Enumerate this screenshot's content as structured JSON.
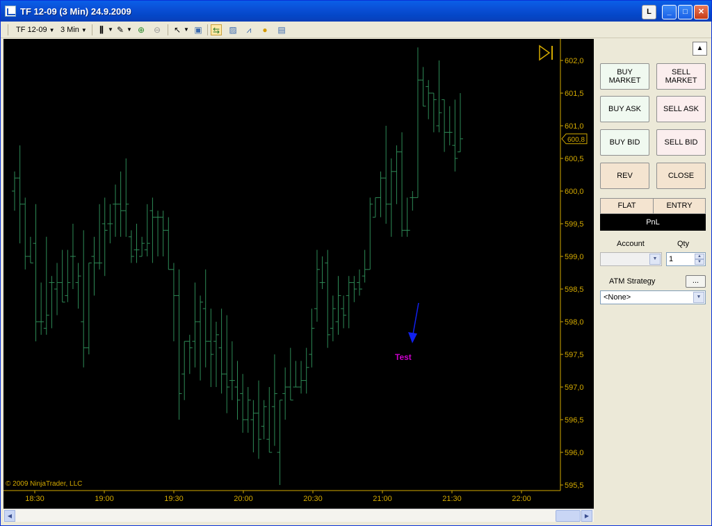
{
  "window": {
    "title": "TF 12-09 (3 Min)  24.9.2009",
    "btn_l": "L",
    "btn_min": "_",
    "btn_max": "□",
    "btn_close": "✕"
  },
  "toolbar": {
    "instrument": "TF 12-09",
    "interval": "3 Min"
  },
  "chart": {
    "copyright": "© 2009 NinjaTrader, LLC",
    "annotation_text": "Test",
    "last_price_label": "600,8",
    "colors": {
      "bar": "#2e8b57",
      "axis": "#d4aa00",
      "annotation": "#cc00cc",
      "arrow": "#1020ee"
    }
  },
  "chart_data": {
    "type": "ohlc",
    "y_axis_ticks": [
      "602,0",
      "601,5",
      "601,0",
      "600,5",
      "600,0",
      "599,5",
      "599,0",
      "598,5",
      "598,0",
      "597,5",
      "597,0",
      "596,5",
      "596,0",
      "595,5"
    ],
    "x_axis_ticks": [
      "18:30",
      "19:00",
      "19:30",
      "20:00",
      "20:30",
      "21:00",
      "21:30",
      "22:00"
    ],
    "ylim": [
      595.4,
      602.2
    ],
    "last_price": 600.8,
    "bars": [
      {
        "o": 600.0,
        "h": 600.3,
        "l": 599.7,
        "c": 600.2
      },
      {
        "o": 600.2,
        "h": 600.7,
        "l": 599.2,
        "c": 599.8
      },
      {
        "o": 599.8,
        "h": 599.9,
        "l": 598.8,
        "c": 599.0
      },
      {
        "o": 599.0,
        "h": 599.3,
        "l": 598.9,
        "c": 598.9
      },
      {
        "o": 599.2,
        "h": 599.8,
        "l": 597.7,
        "c": 598.0
      },
      {
        "o": 598.0,
        "h": 598.6,
        "l": 597.8,
        "c": 598.0
      },
      {
        "o": 597.9,
        "h": 599.3,
        "l": 597.8,
        "c": 598.1
      },
      {
        "o": 598.6,
        "h": 598.7,
        "l": 597.9,
        "c": 598.6
      },
      {
        "o": 598.5,
        "h": 598.9,
        "l": 598.1,
        "c": 598.6
      },
      {
        "o": 598.6,
        "h": 599.1,
        "l": 598.3,
        "c": 598.3
      },
      {
        "o": 598.4,
        "h": 599.1,
        "l": 598.3,
        "c": 598.6
      },
      {
        "o": 599.0,
        "h": 599.5,
        "l": 598.5,
        "c": 599.0
      },
      {
        "o": 598.6,
        "h": 598.9,
        "l": 598.2,
        "c": 598.7
      },
      {
        "o": 598.0,
        "h": 599.4,
        "l": 597.3,
        "c": 597.6
      },
      {
        "o": 597.6,
        "h": 598.9,
        "l": 597.5,
        "c": 598.9
      },
      {
        "o": 599.0,
        "h": 599.3,
        "l": 598.4,
        "c": 598.9
      },
      {
        "o": 598.9,
        "h": 599.8,
        "l": 598.8,
        "c": 598.9
      },
      {
        "o": 599.5,
        "h": 599.9,
        "l": 598.7,
        "c": 599.4
      },
      {
        "o": 599.5,
        "h": 599.8,
        "l": 599.2,
        "c": 599.5
      },
      {
        "o": 599.8,
        "h": 600.1,
        "l": 599.3,
        "c": 599.8
      },
      {
        "o": 599.8,
        "h": 600.3,
        "l": 599.3,
        "c": 599.7
      },
      {
        "o": 599.7,
        "h": 600.5,
        "l": 599.3,
        "c": 599.8
      },
      {
        "o": 599.3,
        "h": 599.4,
        "l": 598.9,
        "c": 599.0
      },
      {
        "o": 599.1,
        "h": 599.5,
        "l": 598.9,
        "c": 599.1
      },
      {
        "o": 599.0,
        "h": 599.3,
        "l": 599.0,
        "c": 599.2
      },
      {
        "o": 599.1,
        "h": 599.8,
        "l": 599.0,
        "c": 599.2
      },
      {
        "o": 599.7,
        "h": 599.9,
        "l": 598.9,
        "c": 599.6
      },
      {
        "o": 599.6,
        "h": 599.7,
        "l": 599.0,
        "c": 599.6
      },
      {
        "o": 599.6,
        "h": 599.7,
        "l": 599.0,
        "c": 599.4
      },
      {
        "o": 599.4,
        "h": 599.6,
        "l": 598.8,
        "c": 598.8
      },
      {
        "o": 598.8,
        "h": 598.9,
        "l": 597.7,
        "c": 598.4
      },
      {
        "o": 598.4,
        "h": 598.8,
        "l": 596.5,
        "c": 596.9
      },
      {
        "o": 597.2,
        "h": 597.7,
        "l": 596.8,
        "c": 597.7
      },
      {
        "o": 597.7,
        "h": 597.8,
        "l": 597.2,
        "c": 597.6
      },
      {
        "o": 597.7,
        "h": 598.6,
        "l": 597.3,
        "c": 598.0
      },
      {
        "o": 598.0,
        "h": 598.4,
        "l": 597.1,
        "c": 598.3
      },
      {
        "o": 598.2,
        "h": 598.8,
        "l": 597.3,
        "c": 597.7
      },
      {
        "o": 597.7,
        "h": 598.2,
        "l": 597.0,
        "c": 597.5
      },
      {
        "o": 597.7,
        "h": 598.0,
        "l": 597.0,
        "c": 597.8
      },
      {
        "o": 597.6,
        "h": 598.2,
        "l": 596.9,
        "c": 597.2
      },
      {
        "o": 597.2,
        "h": 598.1,
        "l": 596.6,
        "c": 597.0
      },
      {
        "o": 597.1,
        "h": 597.7,
        "l": 596.8,
        "c": 597.1
      },
      {
        "o": 597.0,
        "h": 597.4,
        "l": 596.5,
        "c": 596.8
      },
      {
        "o": 596.9,
        "h": 597.2,
        "l": 596.3,
        "c": 596.5
      },
      {
        "o": 596.5,
        "h": 597.0,
        "l": 596.3,
        "c": 596.8
      },
      {
        "o": 596.5,
        "h": 596.8,
        "l": 596.0,
        "c": 596.6
      },
      {
        "o": 596.6,
        "h": 597.1,
        "l": 595.9,
        "c": 596.2
      },
      {
        "o": 596.4,
        "h": 596.8,
        "l": 596.2,
        "c": 596.7
      },
      {
        "o": 596.2,
        "h": 597.0,
        "l": 596.0,
        "c": 596.0
      },
      {
        "o": 596.7,
        "h": 597.5,
        "l": 596.1,
        "c": 596.9
      },
      {
        "o": 596.0,
        "h": 596.8,
        "l": 595.5,
        "c": 596.8
      },
      {
        "o": 596.9,
        "h": 597.3,
        "l": 596.5,
        "c": 597.0
      },
      {
        "o": 597.0,
        "h": 597.6,
        "l": 596.8,
        "c": 596.8
      },
      {
        "o": 597.0,
        "h": 597.4,
        "l": 597.0,
        "c": 597.0
      },
      {
        "o": 597.0,
        "h": 597.4,
        "l": 596.9,
        "c": 597.1
      },
      {
        "o": 597.1,
        "h": 597.6,
        "l": 596.9,
        "c": 597.3
      },
      {
        "o": 597.5,
        "h": 598.2,
        "l": 597.3,
        "c": 597.9
      },
      {
        "o": 598.2,
        "h": 599.1,
        "l": 598.0,
        "c": 598.8
      },
      {
        "o": 598.6,
        "h": 599.0,
        "l": 598.5,
        "c": 598.6
      },
      {
        "o": 598.9,
        "h": 599.1,
        "l": 597.6,
        "c": 597.8
      },
      {
        "o": 597.9,
        "h": 598.4,
        "l": 597.7,
        "c": 598.2
      },
      {
        "o": 598.0,
        "h": 598.7,
        "l": 597.8,
        "c": 598.4
      },
      {
        "o": 598.2,
        "h": 598.4,
        "l": 597.9,
        "c": 598.1
      },
      {
        "o": 598.4,
        "h": 598.7,
        "l": 597.9,
        "c": 598.6
      },
      {
        "o": 598.6,
        "h": 598.7,
        "l": 598.3,
        "c": 598.5
      },
      {
        "o": 598.6,
        "h": 598.8,
        "l": 598.4,
        "c": 598.5
      },
      {
        "o": 598.7,
        "h": 599.1,
        "l": 598.6,
        "c": 598.8
      },
      {
        "o": 598.8,
        "h": 599.9,
        "l": 598.8,
        "c": 599.8
      },
      {
        "o": 599.6,
        "h": 599.9,
        "l": 599.6,
        "c": 599.9
      },
      {
        "o": 599.9,
        "h": 600.3,
        "l": 599.6,
        "c": 600.2
      },
      {
        "o": 600.2,
        "h": 601.0,
        "l": 599.5,
        "c": 599.8
      },
      {
        "o": 599.8,
        "h": 600.5,
        "l": 599.3,
        "c": 600.3
      },
      {
        "o": 600.3,
        "h": 600.7,
        "l": 599.8,
        "c": 600.6
      },
      {
        "o": 600.6,
        "h": 600.9,
        "l": 599.3,
        "c": 599.4
      },
      {
        "o": 599.4,
        "h": 599.9,
        "l": 599.3,
        "c": 599.4
      },
      {
        "o": 599.9,
        "h": 600.0,
        "l": 599.7,
        "c": 599.9
      },
      {
        "o": 599.9,
        "h": 602.2,
        "l": 599.9,
        "c": 601.7
      },
      {
        "o": 601.7,
        "h": 601.9,
        "l": 601.3,
        "c": 601.3
      },
      {
        "o": 601.6,
        "h": 601.7,
        "l": 601.1,
        "c": 601.5
      },
      {
        "o": 601.5,
        "h": 601.5,
        "l": 600.9,
        "c": 601.4
      },
      {
        "o": 601.0,
        "h": 602.0,
        "l": 600.9,
        "c": 601.2
      },
      {
        "o": 601.4,
        "h": 601.4,
        "l": 600.6,
        "c": 600.9
      },
      {
        "o": 600.9,
        "h": 601.3,
        "l": 600.7,
        "c": 600.9
      },
      {
        "o": 600.7,
        "h": 601.4,
        "l": 600.3,
        "c": 600.5
      },
      {
        "o": 600.6,
        "h": 601.5,
        "l": 600.6,
        "c": 600.8
      }
    ]
  },
  "panel": {
    "buy_market": "BUY MARKET",
    "sell_market": "SELL MARKET",
    "buy_ask": "BUY ASK",
    "sell_ask": "SELL ASK",
    "buy_bid": "BUY BID",
    "sell_bid": "SELL BID",
    "rev": "REV",
    "close": "CLOSE",
    "flat": "FLAT",
    "entry": "ENTRY",
    "pnl": "PnL",
    "account_label": "Account",
    "account_value": "",
    "qty_label": "Qty",
    "qty_value": "1",
    "atm_label": "ATM Strategy",
    "atm_button": "...",
    "atm_value": "<None>"
  }
}
